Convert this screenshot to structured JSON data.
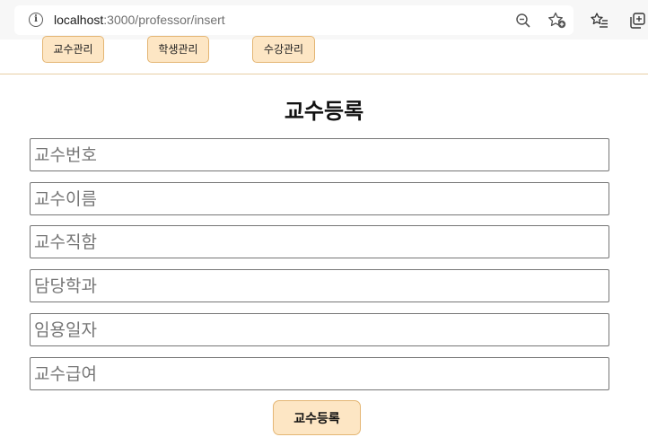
{
  "browser": {
    "url_host": "localhost",
    "url_path": ":3000/professor/insert",
    "icons": [
      "info-icon",
      "zoom-out-icon",
      "add-favorite-icon",
      "favorites-list-icon",
      "collections-icon"
    ]
  },
  "nav": {
    "items": [
      {
        "label": "교수관리"
      },
      {
        "label": "학생관리"
      },
      {
        "label": "수강관리"
      }
    ],
    "button_color": "#fde6c4",
    "border_color": "#e4b674"
  },
  "form": {
    "title": "교수등록",
    "fields": [
      {
        "placeholder": "교수번호",
        "value": ""
      },
      {
        "placeholder": "교수이름",
        "value": ""
      },
      {
        "placeholder": "교수직함",
        "value": ""
      },
      {
        "placeholder": "담당학과",
        "value": ""
      },
      {
        "placeholder": "임용일자",
        "value": ""
      },
      {
        "placeholder": "교수급여",
        "value": ""
      }
    ],
    "submit_label": "교수등록"
  }
}
